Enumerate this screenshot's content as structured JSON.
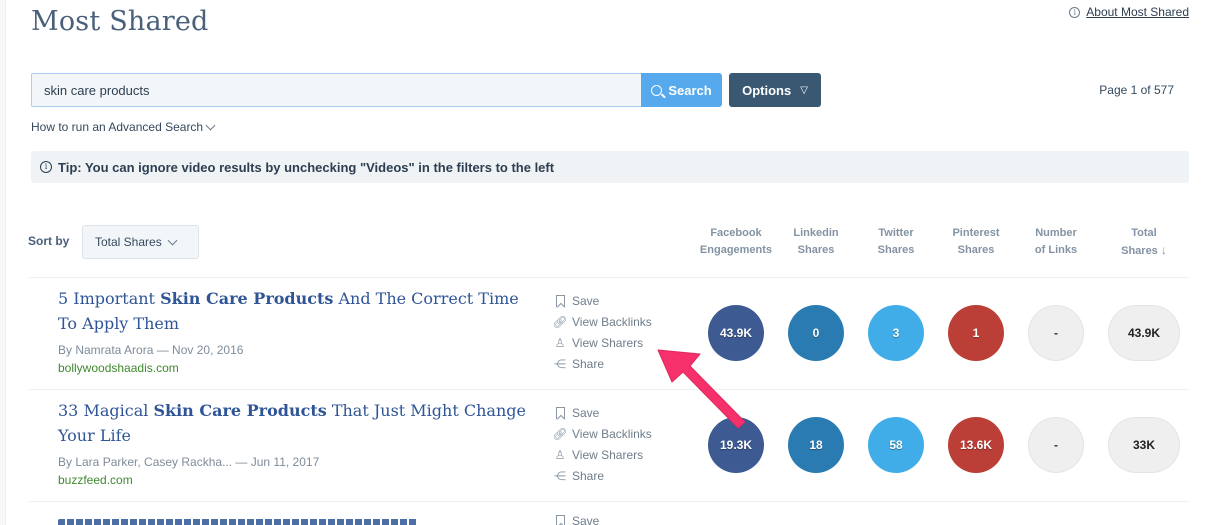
{
  "header": {
    "title": "Most Shared",
    "about_link": "About Most Shared"
  },
  "search": {
    "value": "skin care products",
    "button_label": "Search",
    "options_label": "Options",
    "page_info": "Page 1 of 577",
    "advanced_link": "How to run an Advanced Search"
  },
  "tip": {
    "text": "Tip: You can ignore video results by unchecking \"Videos\" in the filters to the left"
  },
  "sort": {
    "label": "Sort by",
    "selected": "Total Shares"
  },
  "columns": [
    {
      "line1": "Facebook",
      "line2": "Engagements"
    },
    {
      "line1": "Linkedin",
      "line2": "Shares"
    },
    {
      "line1": "Twitter",
      "line2": "Shares"
    },
    {
      "line1": "Pinterest",
      "line2": "Shares"
    },
    {
      "line1": "Number",
      "line2": "of Links"
    },
    {
      "line1": "Total",
      "line2": "Shares",
      "sort_arrow": "↓"
    }
  ],
  "actions": {
    "save": "Save",
    "backlinks": "View Backlinks",
    "sharers": "View Sharers",
    "share": "Share"
  },
  "results": [
    {
      "title_pre": "5 Important ",
      "title_bold": "Skin Care Products",
      "title_post": " And The Correct Time To Apply Them",
      "author": "By Namrata Arora",
      "date": "Nov 20, 2016",
      "domain": "bollywoodshaadis.com",
      "facebook": "43.9K",
      "linkedin": "0",
      "twitter": "3",
      "pinterest": "1",
      "links": "-",
      "total": "43.9K"
    },
    {
      "title_pre": "33 Magical ",
      "title_bold": "Skin Care Products",
      "title_post": " That Just Might Change Your Life",
      "author": "By Lara Parker, Casey Rackha...",
      "date": "Jun 11, 2017",
      "domain": "buzzfeed.com",
      "facebook": "19.3K",
      "linkedin": "18",
      "twitter": "58",
      "pinterest": "13.6K",
      "links": "-",
      "total": "33K"
    }
  ],
  "colors": {
    "facebook": "#3d5a93",
    "linkedin": "#2b7bb3",
    "twitter": "#40ade8",
    "pinterest": "#bb3f37",
    "annotation_arrow": "#f5306a"
  }
}
